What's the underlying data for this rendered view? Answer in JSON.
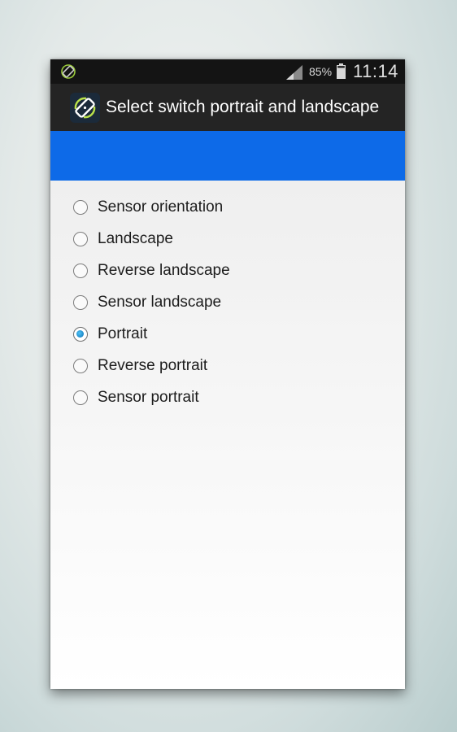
{
  "status_bar": {
    "battery_percent": "85%",
    "time": "11:14",
    "icons": [
      "screen-rotation-icon",
      "cell-signal-icon",
      "battery-icon"
    ]
  },
  "action_bar": {
    "title": "Select switch portrait and landscape",
    "icon": "screen-rotation-icon"
  },
  "colors": {
    "status_bar": "#141414",
    "action_bar": "#242424",
    "accent_band": "#0d6ae8",
    "radio_checked": "#1e88c7"
  },
  "orientation_options": {
    "selected": "Portrait",
    "items": [
      {
        "label": "Sensor orientation",
        "checked": false
      },
      {
        "label": "Landscape",
        "checked": false
      },
      {
        "label": "Reverse landscape",
        "checked": false
      },
      {
        "label": "Sensor landscape",
        "checked": false
      },
      {
        "label": "Portrait",
        "checked": true
      },
      {
        "label": "Reverse portrait",
        "checked": false
      },
      {
        "label": "Sensor portrait",
        "checked": false
      }
    ]
  }
}
